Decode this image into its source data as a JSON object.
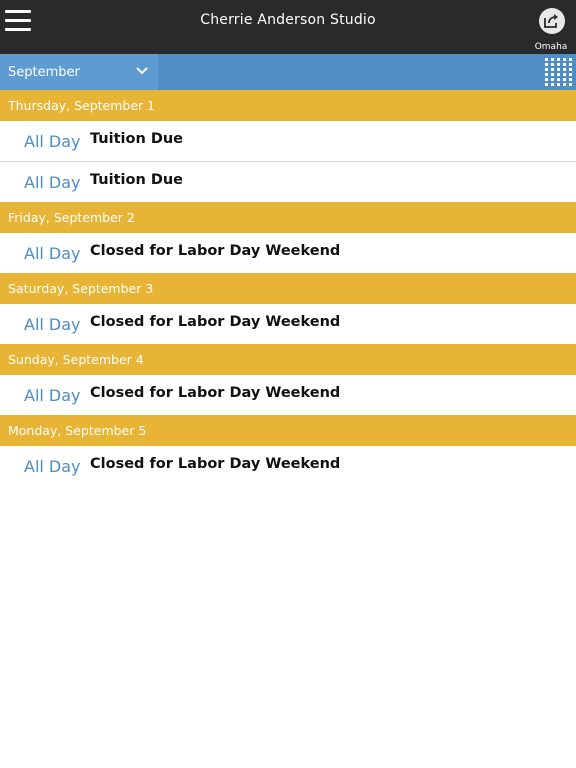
{
  "header": {
    "title": "Cherrie Anderson Studio",
    "location": "Omaha",
    "menu_icon": "hamburger-menu-icon",
    "share_icon": "share-icon"
  },
  "filter": {
    "month": "September",
    "dropdown_icon": "chevron-down-icon",
    "view_toggle_icon": "grid-view-icon"
  },
  "colors": {
    "topbar": "#2a2a2a",
    "filterbar": "#4f8fc4",
    "day_header": "#e8b435",
    "time_text": "#4d8cc8"
  },
  "days": [
    {
      "label": "Thursday, September 1",
      "events": [
        {
          "time": "All Day",
          "title": "Tuition Due"
        },
        {
          "time": "All Day",
          "title": "Tuition Due"
        }
      ]
    },
    {
      "label": "Friday, September 2",
      "events": [
        {
          "time": "All Day",
          "title": "Closed for Labor Day Weekend"
        }
      ]
    },
    {
      "label": "Saturday, September 3",
      "events": [
        {
          "time": "All Day",
          "title": "Closed for Labor Day Weekend"
        }
      ]
    },
    {
      "label": "Sunday, September 4",
      "events": [
        {
          "time": "All Day",
          "title": "Closed for Labor Day Weekend"
        }
      ]
    },
    {
      "label": "Monday, September 5",
      "events": [
        {
          "time": "All Day",
          "title": "Closed for Labor Day Weekend"
        }
      ]
    }
  ]
}
